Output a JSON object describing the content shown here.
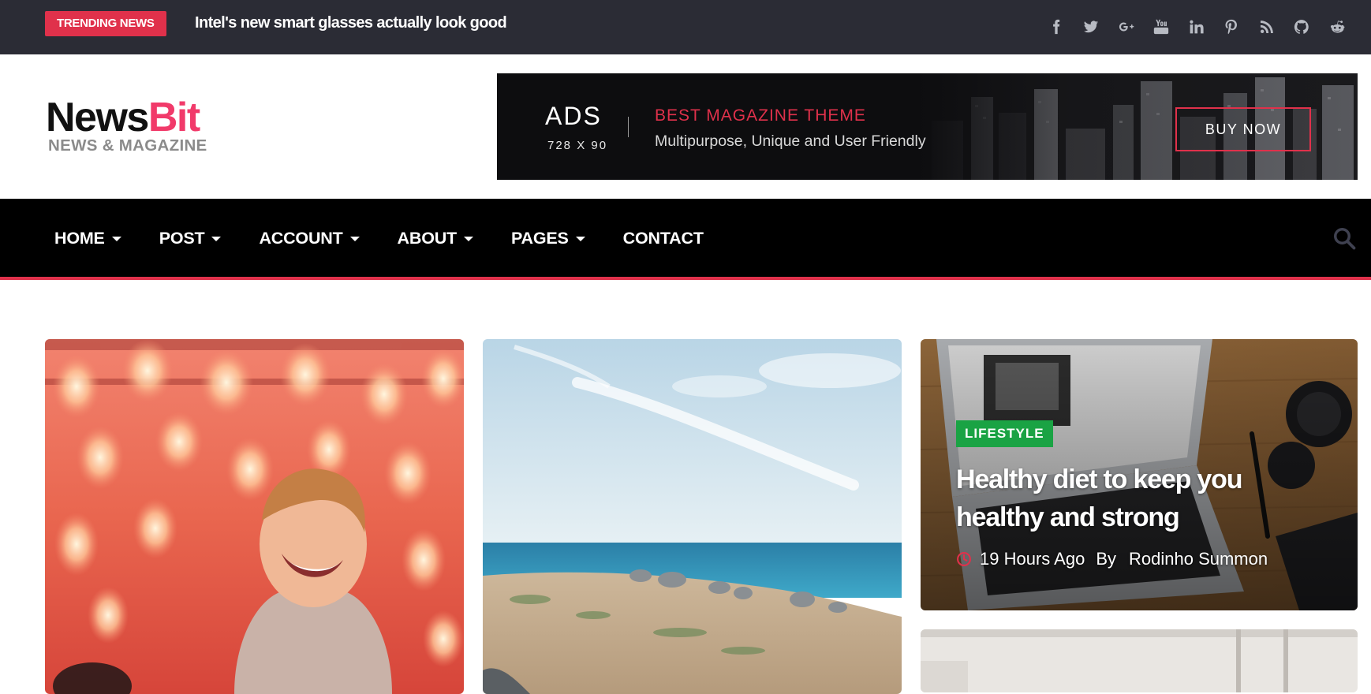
{
  "topbar": {
    "trending_label": "TRENDING NEWS",
    "trending_headline": "Intel's new smart glasses actually look good",
    "social_icons": [
      "facebook-icon",
      "twitter-icon",
      "google-plus-icon",
      "youtube-icon",
      "linkedin-icon",
      "pinterest-icon",
      "rss-icon",
      "github-icon",
      "reddit-icon"
    ]
  },
  "logo": {
    "name_part1": "News",
    "name_part2": "Bit",
    "tagline": "NEWS & MAGAZINE"
  },
  "ad": {
    "label": "ADS",
    "size": "728 X 90",
    "title": "BEST MAGAZINE THEME",
    "description": "Multipurpose, Unique and User Friendly",
    "button": "BUY NOW"
  },
  "nav": {
    "items": [
      {
        "label": "HOME",
        "has_dropdown": true
      },
      {
        "label": "POST",
        "has_dropdown": true
      },
      {
        "label": "ACCOUNT",
        "has_dropdown": true
      },
      {
        "label": "ABOUT",
        "has_dropdown": true
      },
      {
        "label": "PAGES",
        "has_dropdown": true
      },
      {
        "label": "CONTACT",
        "has_dropdown": false
      }
    ],
    "search_icon": "search-icon"
  },
  "featured": {
    "category": "LIFESTYLE",
    "title": "Healthy diet to keep you healthy and strong",
    "time": "19 Hours Ago",
    "by": "By",
    "author": "Rodinho Summon"
  },
  "colors": {
    "accent": "#e0314b",
    "topbar_bg": "#2b2c35",
    "nav_bg": "#000000",
    "category_green": "#1aa344",
    "logo_pink": "#f13a6a"
  }
}
